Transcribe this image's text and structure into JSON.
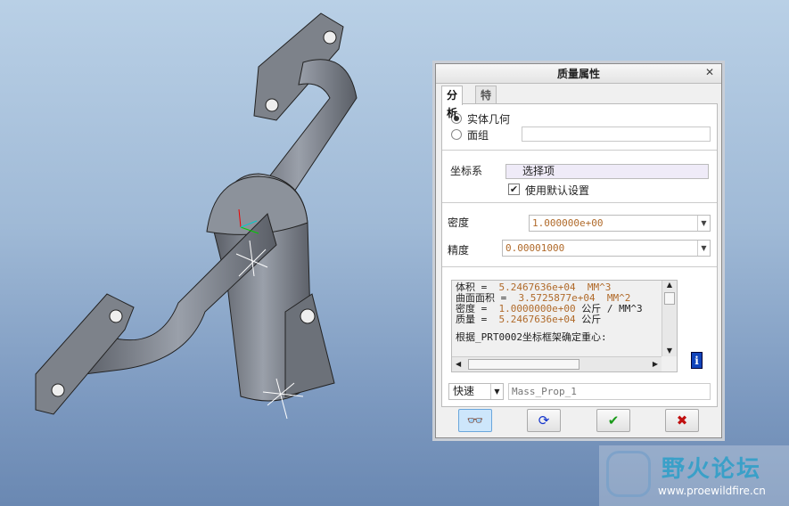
{
  "dialog": {
    "title": "质量属性",
    "close_icon": "close-icon"
  },
  "tabs": [
    {
      "label": "分析",
      "active": true
    },
    {
      "label": "特征",
      "active": false
    }
  ],
  "geometry": {
    "solid_label": "实体几何",
    "quilt_label": "面组",
    "selected": "solid"
  },
  "csys": {
    "label": "坐标系",
    "value": "选择项",
    "use_default_label": "使用默认设置",
    "use_default_checked": true
  },
  "density": {
    "label": "密度",
    "value": "1.000000e+00"
  },
  "accuracy": {
    "label": "精度",
    "value": "0.00001000"
  },
  "output": {
    "lines": [
      {
        "label": "体积 = ",
        "value": "5.2467636e+04",
        "unit": "MM^3"
      },
      {
        "label": "曲面面积 = ",
        "value": "3.5725877e+04",
        "unit": "MM^2"
      },
      {
        "label": "密度 = ",
        "value": "1.0000000e+00",
        "unit": "公斤 / MM^3"
      },
      {
        "label": "质量 = ",
        "value": "5.2467636e+04",
        "unit": "公斤"
      }
    ],
    "footer": "根据_PRT0002坐标框架确定重心:"
  },
  "mode": {
    "value": "快速"
  },
  "name_field": {
    "placeholder": "Mass_Prop_1"
  },
  "buttons": {
    "preview": "glasses-icon",
    "regenerate": "refresh-icon",
    "ok": "check-icon",
    "cancel": "x-icon"
  },
  "watermark": {
    "title": "野火论坛",
    "url": "www.proewildfire.cn"
  }
}
